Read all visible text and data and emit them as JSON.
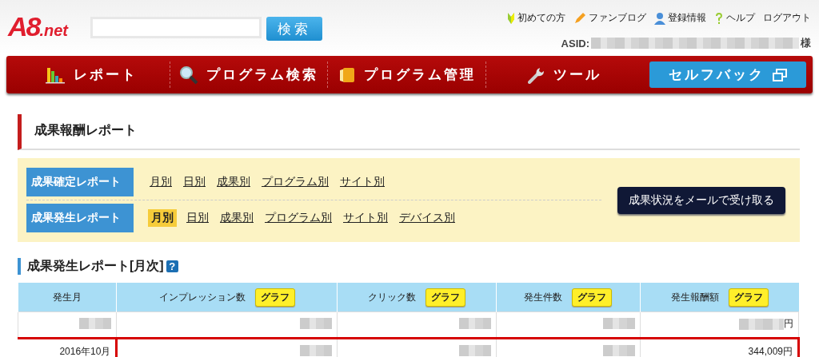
{
  "header": {
    "logo": {
      "main": "A8",
      "suffix": ".net"
    },
    "search": {
      "button": "検索"
    },
    "top_links": [
      {
        "label": "初めての方"
      },
      {
        "label": "ファンブログ"
      },
      {
        "label": "登録情報"
      },
      {
        "label": "ヘルプ"
      },
      {
        "label": "ログアウト"
      }
    ],
    "asid": {
      "label": "ASID:",
      "blurred": true,
      "suffix": "様"
    }
  },
  "nav": [
    {
      "label": "レポート",
      "kind": "menu"
    },
    {
      "label": "プログラム検索",
      "kind": "menu"
    },
    {
      "label": "プログラム管理",
      "kind": "menu"
    },
    {
      "label": "ツール",
      "kind": "menu"
    },
    {
      "label": "セルフバック",
      "kind": "external"
    }
  ],
  "page_title": "成果報酬レポート",
  "report_panel": {
    "groups": [
      {
        "title": "成果確定レポート",
        "links": [
          {
            "label": "月別",
            "selected": false
          },
          {
            "label": "日別",
            "selected": false
          },
          {
            "label": "成果別",
            "selected": false
          },
          {
            "label": "プログラム別",
            "selected": false
          },
          {
            "label": "サイト別",
            "selected": false
          }
        ]
      },
      {
        "title": "成果発生レポート",
        "links": [
          {
            "label": "月別",
            "selected": true
          },
          {
            "label": "日別",
            "selected": false
          },
          {
            "label": "成果別",
            "selected": false
          },
          {
            "label": "プログラム別",
            "selected": false
          },
          {
            "label": "サイト別",
            "selected": false
          },
          {
            "label": "デバイス別",
            "selected": false
          }
        ]
      }
    ],
    "mail_button": "成果状況をメールで受け取る"
  },
  "section_title": "成果発生レポート[月次]",
  "section_help": "?",
  "table": {
    "columns": [
      {
        "label": "発生月"
      },
      {
        "label": "インプレッション数",
        "graph": "グラフ"
      },
      {
        "label": "クリック数",
        "graph": "グラフ"
      },
      {
        "label": "発生件数",
        "graph": "グラフ"
      },
      {
        "label": "発生報酬額",
        "graph": "グラフ"
      }
    ],
    "rows": [
      {
        "highlighted": false,
        "cells": [
          {
            "blurred": true
          },
          {
            "blurred": true
          },
          {
            "blurred": true
          },
          {
            "blurred": true
          },
          {
            "blurred": true,
            "text": "円"
          }
        ]
      },
      {
        "highlighted": true,
        "cells": [
          {
            "blurred": false,
            "text": "2016年10月"
          },
          {
            "blurred": true
          },
          {
            "blurred": true
          },
          {
            "blurred": true
          },
          {
            "blurred": false,
            "text": "344,009円"
          }
        ]
      }
    ]
  }
}
